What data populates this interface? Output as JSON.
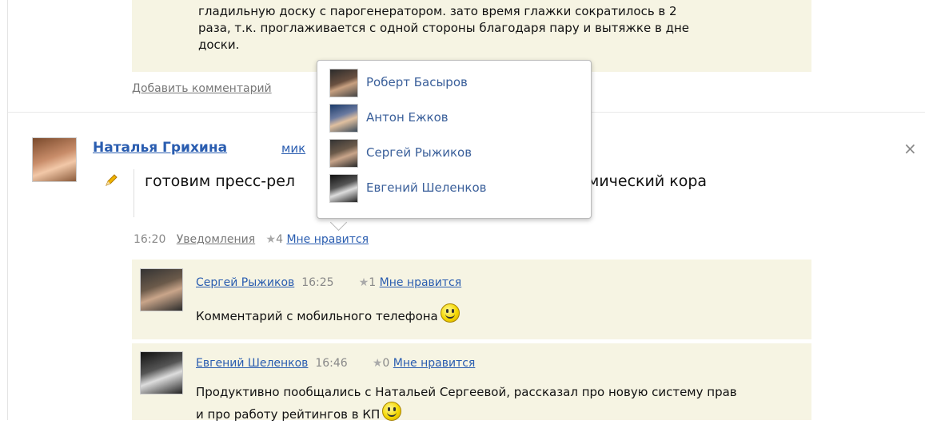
{
  "prev_post": {
    "comment_text": "гладильную доску с парогенератором. зато время глажки сократилось в 2 раза, т.к. проглаживается с одной стороны благодаря пару и вытяжке в дне доски.",
    "add_comment_label": "Добавить комментарий"
  },
  "post": {
    "author": "Наталья Грихина",
    "author_extra": "мик",
    "text": "готовим пресс-рел                                         учается космический кора",
    "time": "16:20",
    "notifications_label": "Уведомления",
    "like_count": "4",
    "like_label": "Мне нравится",
    "close_glyph": "×"
  },
  "likes_popup": {
    "users": [
      {
        "name": "Роберт Басыров"
      },
      {
        "name": "Антон Ежков"
      },
      {
        "name": "Сергей Рыжиков"
      },
      {
        "name": "Евгений Шеленков"
      }
    ]
  },
  "comments": [
    {
      "author": "Сергей Рыжиков",
      "time": "16:25",
      "like_count": "1",
      "like_label": "Мне нравится",
      "text": "Комментарий с мобильного телефона"
    },
    {
      "author": "Евгений Шеленков",
      "time": "16:46",
      "like_count": "0",
      "like_label": "Мне нравится",
      "text": "Продуктивно пообщались с Натальей Сергеевой, рассказал про новую систему прав и про работу рейтингов в КП"
    }
  ],
  "icons": {
    "star": "★",
    "pencil": "pencil-icon",
    "smiley": "smiley-icon"
  },
  "colors": {
    "link": "#2a5db0",
    "comment_bg": "#f6f4e3"
  }
}
